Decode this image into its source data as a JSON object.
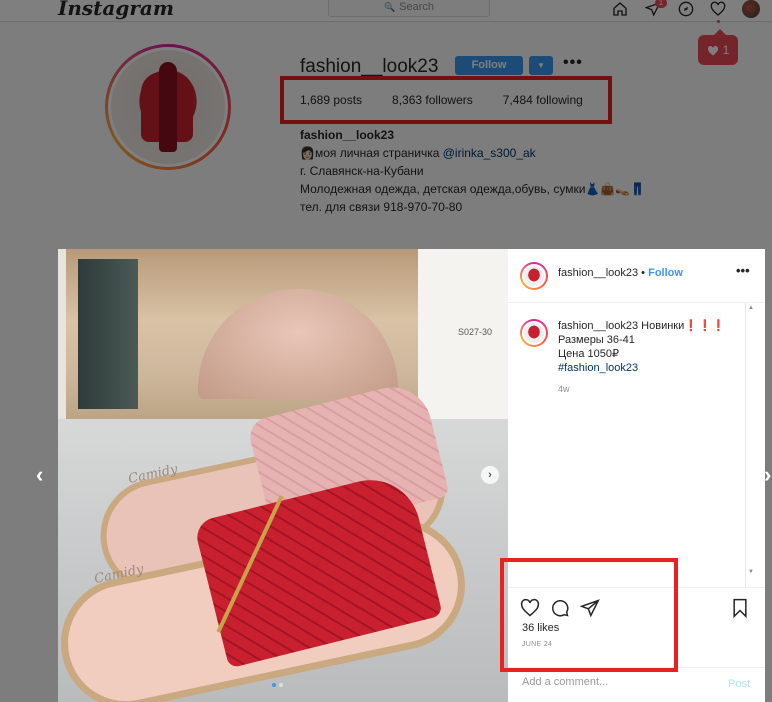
{
  "header": {
    "logo": "Instagram",
    "search_placeholder": "Search",
    "direct_badge": "1",
    "notification_count": "1"
  },
  "profile": {
    "username": "fashion__look23",
    "follow_label": "Follow",
    "stats": {
      "posts": "1,689 posts",
      "followers": "8,363 followers",
      "following": "7,484 following"
    },
    "bio": {
      "name": "fashion__look23",
      "line1_prefix": "👩🏻моя личная страничка ",
      "line1_link": "@irinka_s300_ak",
      "line2": "г. Славянск-на-Кубани",
      "line3": "Молодежная одежда, детская одежда,обувь, сумки👗👜👡👖",
      "line4": "тел. для связи 918-970-70-80"
    }
  },
  "post": {
    "photo": {
      "brand_1": "Camidy",
      "brand_2": "Camidy",
      "code": "S027-30"
    },
    "header_username": "fashion__look23",
    "header_follow": "Follow",
    "caption": {
      "username": "fashion__look23",
      "line1": " Новинки❗❗❗",
      "line2": "Размеры 36-41",
      "line3": "Цена 1050₽",
      "hashtag": "#fashion_look23"
    },
    "age": "4w",
    "likes": "36 likes",
    "date": "JUNE 24",
    "comment_placeholder": "Add a comment...",
    "post_label": "Post"
  },
  "colors": {
    "accent_blue": "#3897f0",
    "notification_red": "#ed4956",
    "highlight_red": "#e8231f"
  }
}
